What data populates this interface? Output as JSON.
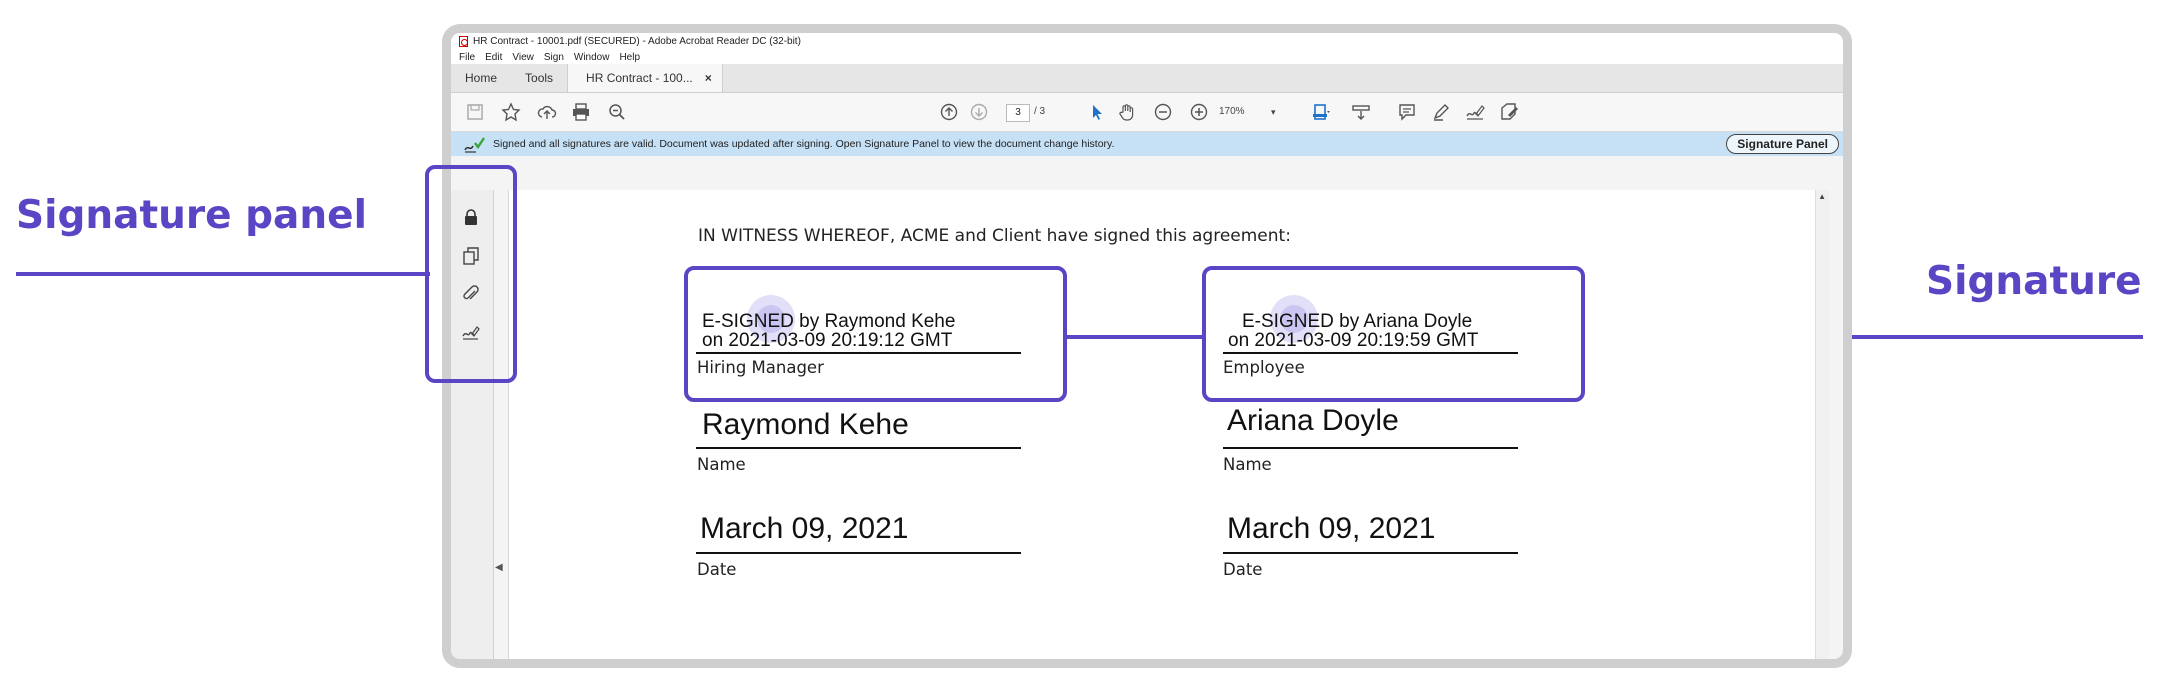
{
  "callouts": {
    "left_label": "Signature panel",
    "right_label": "Signature"
  },
  "window": {
    "title": "HR Contract - 10001.pdf (SECURED) - Adobe Acrobat Reader DC (32-bit)",
    "menu": [
      "File",
      "Edit",
      "View",
      "Sign",
      "Window",
      "Help"
    ],
    "tabs": {
      "home": "Home",
      "tools": "Tools",
      "doc": "HR Contract - 100...",
      "close": "×"
    }
  },
  "toolbar": {
    "page_current": "3",
    "page_total": "/ 3",
    "zoom": "170%",
    "zoom_caret": "▾"
  },
  "infobar": {
    "message": "Signed and all signatures are valid. Document was updated after signing. Open Signature Panel to view the document change history.",
    "button": "Signature Panel"
  },
  "document": {
    "witness": "IN WITNESS WHEREOF, ACME and Client have signed this agreement:",
    "left": {
      "esigned_line1": "E-SIGNED by Raymond Kehe",
      "esigned_line2": "on 2021-03-09 20:19:12 GMT",
      "role": "Hiring Manager",
      "name_value": "Raymond Kehe",
      "name_label": "Name",
      "date_value": "March 09, 2021",
      "date_label": "Date"
    },
    "right": {
      "esigned_line1": "E-SIGNED by Ariana Doyle",
      "esigned_line2": "on 2021-03-09 20:19:59 GMT",
      "role": "Employee",
      "name_value": "Ariana Doyle",
      "name_label": "Name",
      "date_value": "March 09, 2021",
      "date_label": "Date"
    }
  },
  "colors": {
    "accent": "#5a45c4",
    "infobar": "#c6e0f5",
    "toolbar_blue": "#1e73c8"
  },
  "icons": {
    "toolbar": [
      "save-icon",
      "bookmark-star-icon",
      "cloud-upload-icon",
      "print-icon",
      "zoom-out-search-icon",
      "page-up-icon",
      "page-down-icon",
      "select-pointer-icon",
      "hand-icon",
      "zoom-out-icon",
      "zoom-in-icon",
      "fit-page-icon",
      "scroll-mode-icon",
      "comment-icon",
      "highlight-pen-icon",
      "sign-icon",
      "fill-sign-icon"
    ],
    "rail": [
      "lock-icon",
      "pages-icon",
      "attachment-icon",
      "signature-icon"
    ]
  }
}
